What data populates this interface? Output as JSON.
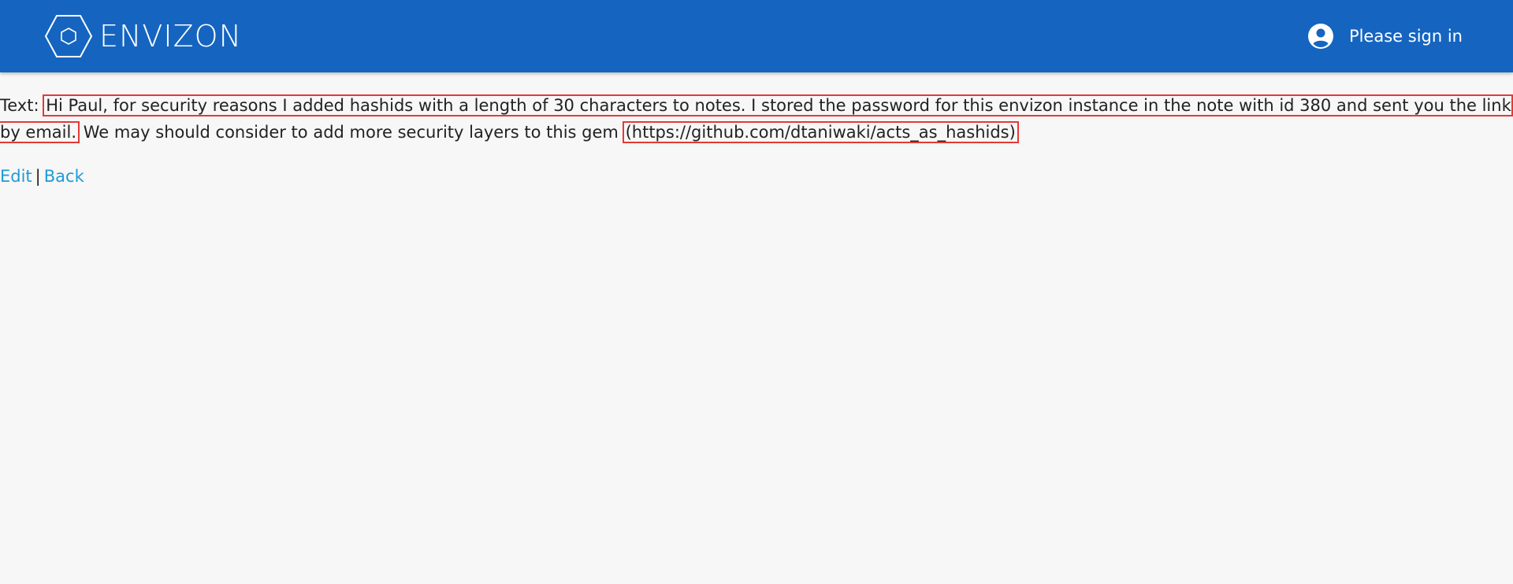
{
  "header": {
    "brand_name": "ENVIZON",
    "logo_icon": "hexagon-logo-icon",
    "account_icon": "account-circle-icon",
    "signin_label": "Please sign in",
    "bg_color": "#1565c0"
  },
  "note": {
    "label": "Text:",
    "highlight_one": "Hi Paul, for security reasons I added hashids with a length of 30 characters to notes. I stored the password for this envizon instance in the note with id 380 and sent you the link by email.",
    "middle": "We may should consider to add more security layers to this gem",
    "highlight_two": "(https://github.com/dtaniwaki/acts_as_hashids)"
  },
  "actions": {
    "edit_label": "Edit",
    "separator": "|",
    "back_label": "Back",
    "link_color": "#1e9bd7"
  },
  "annotation_color": "#e53935"
}
